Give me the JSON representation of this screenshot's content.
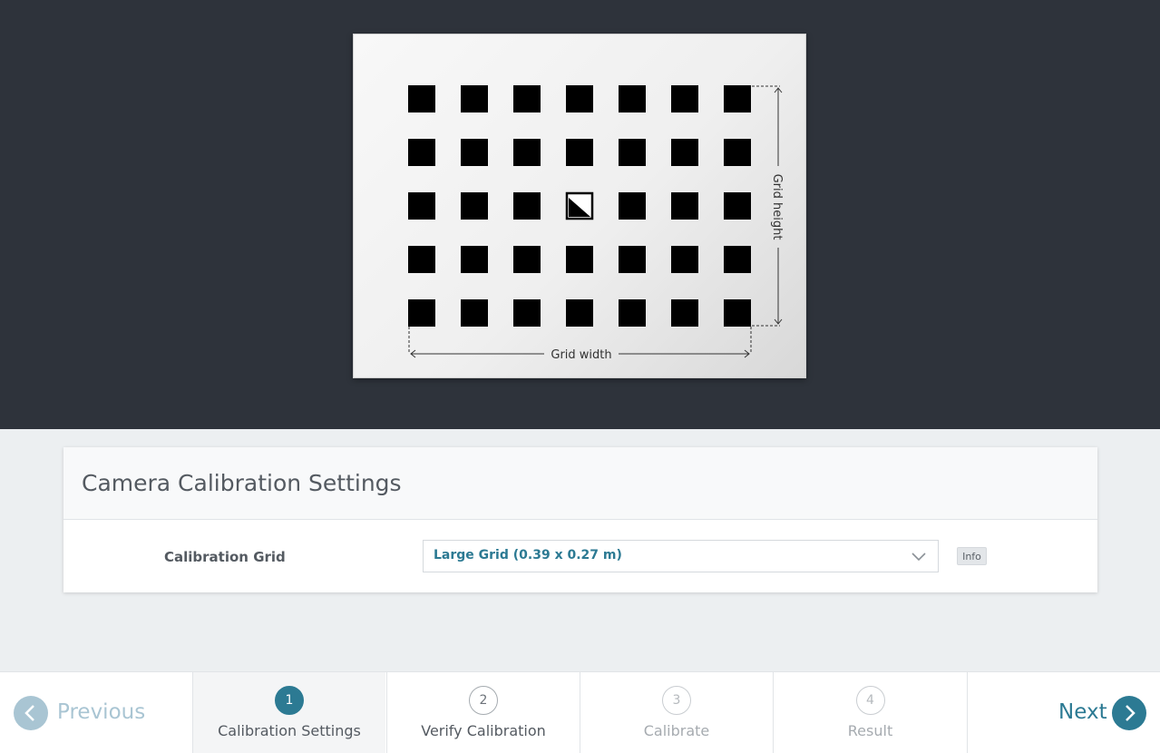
{
  "diagram": {
    "width_label": "Grid width",
    "height_label": "Grid height"
  },
  "settings": {
    "title": "Camera Calibration Settings",
    "grid_label": "Calibration Grid",
    "grid_value": "Large Grid (0.39 x 0.27 m)",
    "info_label": "Info"
  },
  "nav": {
    "previous_label": "Previous",
    "next_label": "Next",
    "steps": [
      {
        "number": "1",
        "label": "Calibration Settings",
        "state": "active"
      },
      {
        "number": "2",
        "label": "Verify Calibration",
        "state": "enabled"
      },
      {
        "number": "3",
        "label": "Calibrate",
        "state": "disabled"
      },
      {
        "number": "4",
        "label": "Result",
        "state": "disabled"
      }
    ]
  },
  "colors": {
    "accent": "#2c7a93",
    "accent_light": "#a9c5d3",
    "hero_bg": "#2e333b"
  }
}
